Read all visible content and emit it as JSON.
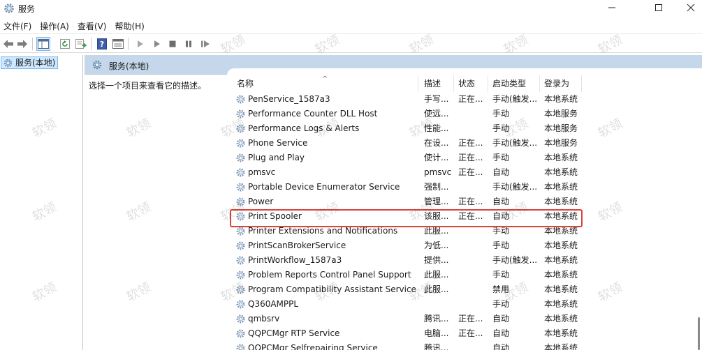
{
  "window": {
    "title": "服务"
  },
  "menu": [
    "文件(F)",
    "操作(A)",
    "查看(V)",
    "帮助(H)"
  ],
  "tree": {
    "selected_label": "服务(本地)"
  },
  "pane": {
    "header_title": "服务(本地)",
    "description_prompt": "选择一个项目来查看它的描述。"
  },
  "columns": {
    "name": "名称",
    "desc": "描述",
    "status": "状态",
    "start": "启动类型",
    "logon": "登录为"
  },
  "services": [
    {
      "name": "PenService_1587a3",
      "desc": "手写...",
      "status": "正在...",
      "start": "手动(触发...",
      "logon": "本地系统"
    },
    {
      "name": "Performance Counter DLL Host",
      "desc": "使远...",
      "status": "",
      "start": "手动",
      "logon": "本地服务"
    },
    {
      "name": "Performance Logs & Alerts",
      "desc": "性能...",
      "status": "",
      "start": "手动",
      "logon": "本地服务"
    },
    {
      "name": "Phone Service",
      "desc": "在设...",
      "status": "正在...",
      "start": "手动(触发...",
      "logon": "本地服务"
    },
    {
      "name": "Plug and Play",
      "desc": "使计...",
      "status": "正在...",
      "start": "手动",
      "logon": "本地系统"
    },
    {
      "name": "pmsvc",
      "desc": "pmsvc",
      "status": "正在...",
      "start": "自动",
      "logon": "本地系统"
    },
    {
      "name": "Portable Device Enumerator Service",
      "desc": "强制...",
      "status": "",
      "start": "手动(触发...",
      "logon": "本地系统"
    },
    {
      "name": "Power",
      "desc": "管理...",
      "status": "正在...",
      "start": "自动",
      "logon": "本地系统"
    },
    {
      "name": "Print Spooler",
      "desc": "该服...",
      "status": "正在...",
      "start": "自动",
      "logon": "本地系统"
    },
    {
      "name": "Printer Extensions and Notifications",
      "desc": "此服...",
      "status": "",
      "start": "手动",
      "logon": "本地系统"
    },
    {
      "name": "PrintScanBrokerService",
      "desc": "为低...",
      "status": "",
      "start": "手动",
      "logon": "本地系统"
    },
    {
      "name": "PrintWorkflow_1587a3",
      "desc": "提供...",
      "status": "",
      "start": "手动(触发...",
      "logon": "本地系统"
    },
    {
      "name": "Problem Reports Control Panel Support",
      "desc": "此服...",
      "status": "",
      "start": "手动",
      "logon": "本地系统"
    },
    {
      "name": "Program Compatibility Assistant Service",
      "desc": "此服...",
      "status": "",
      "start": "禁用",
      "logon": "本地系统"
    },
    {
      "name": "Q360AMPPL",
      "desc": "",
      "status": "",
      "start": "手动",
      "logon": "本地系统"
    },
    {
      "name": "qmbsrv",
      "desc": "腾讯...",
      "status": "正在...",
      "start": "自动",
      "logon": "本地系统"
    },
    {
      "name": "QQPCMgr RTP Service",
      "desc": "电脑...",
      "status": "正在...",
      "start": "自动",
      "logon": "本地系统"
    },
    {
      "name": "QQPCMgr Selfrepairing Service",
      "desc": "腾讯...",
      "status": "",
      "start": "自动",
      "logon": "本地系统"
    }
  ],
  "selected_service": "Print Spooler",
  "watermark_text": "软领",
  "colors": {
    "header_bg": "#c5d7ea",
    "selection_bg": "#cde8ff",
    "highlight_border": "#d9453a"
  }
}
